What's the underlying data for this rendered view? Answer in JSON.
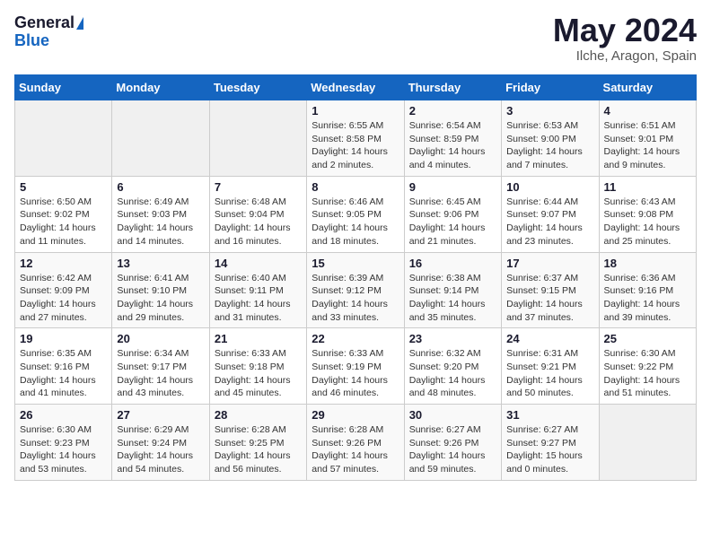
{
  "header": {
    "logo_general": "General",
    "logo_blue": "Blue",
    "month_title": "May 2024",
    "location": "Ilche, Aragon, Spain"
  },
  "days_of_week": [
    "Sunday",
    "Monday",
    "Tuesday",
    "Wednesday",
    "Thursday",
    "Friday",
    "Saturday"
  ],
  "weeks": [
    [
      {
        "day": "",
        "info": ""
      },
      {
        "day": "",
        "info": ""
      },
      {
        "day": "",
        "info": ""
      },
      {
        "day": "1",
        "info": "Sunrise: 6:55 AM\nSunset: 8:58 PM\nDaylight: 14 hours\nand 2 minutes."
      },
      {
        "day": "2",
        "info": "Sunrise: 6:54 AM\nSunset: 8:59 PM\nDaylight: 14 hours\nand 4 minutes."
      },
      {
        "day": "3",
        "info": "Sunrise: 6:53 AM\nSunset: 9:00 PM\nDaylight: 14 hours\nand 7 minutes."
      },
      {
        "day": "4",
        "info": "Sunrise: 6:51 AM\nSunset: 9:01 PM\nDaylight: 14 hours\nand 9 minutes."
      }
    ],
    [
      {
        "day": "5",
        "info": "Sunrise: 6:50 AM\nSunset: 9:02 PM\nDaylight: 14 hours\nand 11 minutes."
      },
      {
        "day": "6",
        "info": "Sunrise: 6:49 AM\nSunset: 9:03 PM\nDaylight: 14 hours\nand 14 minutes."
      },
      {
        "day": "7",
        "info": "Sunrise: 6:48 AM\nSunset: 9:04 PM\nDaylight: 14 hours\nand 16 minutes."
      },
      {
        "day": "8",
        "info": "Sunrise: 6:46 AM\nSunset: 9:05 PM\nDaylight: 14 hours\nand 18 minutes."
      },
      {
        "day": "9",
        "info": "Sunrise: 6:45 AM\nSunset: 9:06 PM\nDaylight: 14 hours\nand 21 minutes."
      },
      {
        "day": "10",
        "info": "Sunrise: 6:44 AM\nSunset: 9:07 PM\nDaylight: 14 hours\nand 23 minutes."
      },
      {
        "day": "11",
        "info": "Sunrise: 6:43 AM\nSunset: 9:08 PM\nDaylight: 14 hours\nand 25 minutes."
      }
    ],
    [
      {
        "day": "12",
        "info": "Sunrise: 6:42 AM\nSunset: 9:09 PM\nDaylight: 14 hours\nand 27 minutes."
      },
      {
        "day": "13",
        "info": "Sunrise: 6:41 AM\nSunset: 9:10 PM\nDaylight: 14 hours\nand 29 minutes."
      },
      {
        "day": "14",
        "info": "Sunrise: 6:40 AM\nSunset: 9:11 PM\nDaylight: 14 hours\nand 31 minutes."
      },
      {
        "day": "15",
        "info": "Sunrise: 6:39 AM\nSunset: 9:12 PM\nDaylight: 14 hours\nand 33 minutes."
      },
      {
        "day": "16",
        "info": "Sunrise: 6:38 AM\nSunset: 9:14 PM\nDaylight: 14 hours\nand 35 minutes."
      },
      {
        "day": "17",
        "info": "Sunrise: 6:37 AM\nSunset: 9:15 PM\nDaylight: 14 hours\nand 37 minutes."
      },
      {
        "day": "18",
        "info": "Sunrise: 6:36 AM\nSunset: 9:16 PM\nDaylight: 14 hours\nand 39 minutes."
      }
    ],
    [
      {
        "day": "19",
        "info": "Sunrise: 6:35 AM\nSunset: 9:16 PM\nDaylight: 14 hours\nand 41 minutes."
      },
      {
        "day": "20",
        "info": "Sunrise: 6:34 AM\nSunset: 9:17 PM\nDaylight: 14 hours\nand 43 minutes."
      },
      {
        "day": "21",
        "info": "Sunrise: 6:33 AM\nSunset: 9:18 PM\nDaylight: 14 hours\nand 45 minutes."
      },
      {
        "day": "22",
        "info": "Sunrise: 6:33 AM\nSunset: 9:19 PM\nDaylight: 14 hours\nand 46 minutes."
      },
      {
        "day": "23",
        "info": "Sunrise: 6:32 AM\nSunset: 9:20 PM\nDaylight: 14 hours\nand 48 minutes."
      },
      {
        "day": "24",
        "info": "Sunrise: 6:31 AM\nSunset: 9:21 PM\nDaylight: 14 hours\nand 50 minutes."
      },
      {
        "day": "25",
        "info": "Sunrise: 6:30 AM\nSunset: 9:22 PM\nDaylight: 14 hours\nand 51 minutes."
      }
    ],
    [
      {
        "day": "26",
        "info": "Sunrise: 6:30 AM\nSunset: 9:23 PM\nDaylight: 14 hours\nand 53 minutes."
      },
      {
        "day": "27",
        "info": "Sunrise: 6:29 AM\nSunset: 9:24 PM\nDaylight: 14 hours\nand 54 minutes."
      },
      {
        "day": "28",
        "info": "Sunrise: 6:28 AM\nSunset: 9:25 PM\nDaylight: 14 hours\nand 56 minutes."
      },
      {
        "day": "29",
        "info": "Sunrise: 6:28 AM\nSunset: 9:26 PM\nDaylight: 14 hours\nand 57 minutes."
      },
      {
        "day": "30",
        "info": "Sunrise: 6:27 AM\nSunset: 9:26 PM\nDaylight: 14 hours\nand 59 minutes."
      },
      {
        "day": "31",
        "info": "Sunrise: 6:27 AM\nSunset: 9:27 PM\nDaylight: 15 hours\nand 0 minutes."
      },
      {
        "day": "",
        "info": ""
      }
    ]
  ]
}
